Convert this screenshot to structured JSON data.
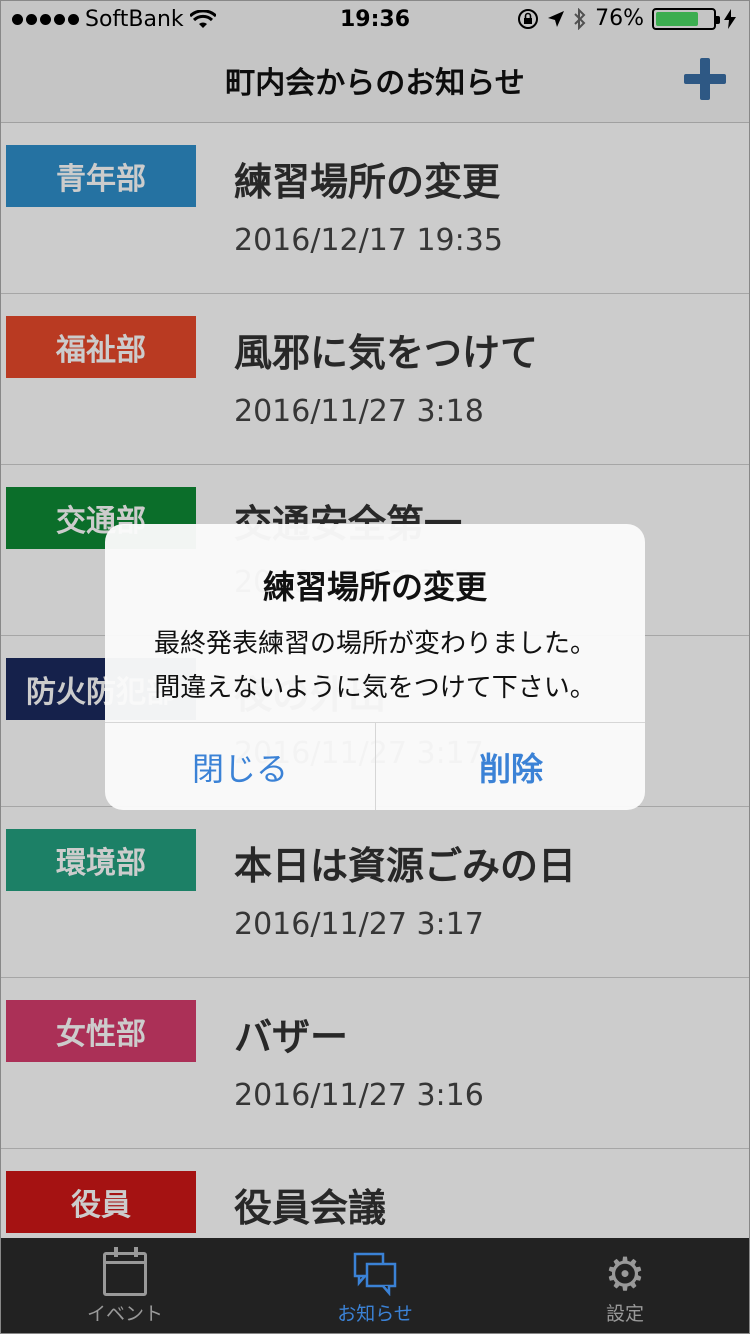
{
  "status_bar": {
    "carrier": "SoftBank",
    "time": "19:36",
    "battery_text": "76%",
    "battery_level": 0.76
  },
  "nav": {
    "title": "町内会からのお知らせ"
  },
  "notices": [
    {
      "dept": "青年部",
      "color": "#2f8fcb",
      "title": "練習場所の変更",
      "date": "2016/12/17 19:35"
    },
    {
      "dept": "福祉部",
      "color": "#e8492b",
      "title": "風邪に気をつけて",
      "date": "2016/11/27 3:18"
    },
    {
      "dept": "交通部",
      "color": "#0e8a35",
      "title": "交通安全第一",
      "date": "2016/11/27 3:17"
    },
    {
      "dept": "防火防犯部",
      "color": "#1b2a5e",
      "title": "夜の外出",
      "date": "2016/11/27 3:17"
    },
    {
      "dept": "環境部",
      "color": "#24a080",
      "title": "本日は資源ごみの日",
      "date": "2016/11/27 3:17"
    },
    {
      "dept": "女性部",
      "color": "#d63d6d",
      "title": "バザー",
      "date": "2016/11/27 3:16"
    },
    {
      "dept": "役員",
      "color": "#cf1717",
      "title": "役員会議",
      "date": ""
    }
  ],
  "alert": {
    "title": "練習場所の変更",
    "message_line1": "最終発表練習の場所が変わりました。",
    "message_line2": "間違えないように気をつけて下さい。",
    "close_label": "閉じる",
    "delete_label": "削除"
  },
  "tabs": [
    {
      "label": "イベント",
      "icon": "calendar-icon",
      "active": false
    },
    {
      "label": "お知らせ",
      "icon": "chat-bubbles-icon",
      "active": true
    },
    {
      "label": "設定",
      "icon": "gear-icon",
      "active": false
    }
  ],
  "colors": {
    "accent": "#3b82d6",
    "tab_active": "#3b82d6",
    "tab_inactive": "#999999"
  }
}
